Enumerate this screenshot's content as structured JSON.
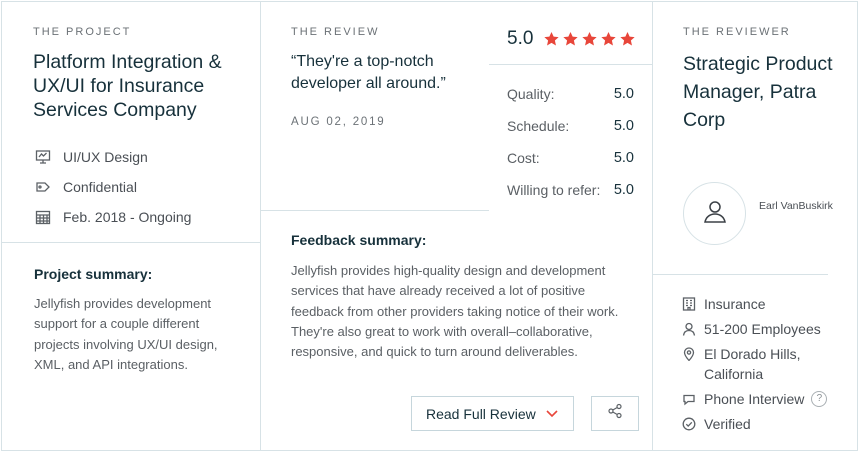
{
  "project": {
    "eyebrow": "THE PROJECT",
    "title": "Platform Integration & UX/UI for Insurance Services Company",
    "meta": [
      {
        "icon": "design-icon",
        "label": "UI/UX Design"
      },
      {
        "icon": "price-tag-icon",
        "label": "Confidential"
      },
      {
        "icon": "calendar-icon",
        "label": "Feb. 2018 - Ongoing"
      }
    ],
    "summary_heading": "Project summary:",
    "summary_text": "Jellyfish provides development support for a couple different projects involving UX/UI design, XML, and API integrations."
  },
  "review": {
    "eyebrow": "THE REVIEW",
    "quote": "“They're a top-notch developer all around.”",
    "date": "AUG 02, 2019",
    "overall_score": "5.0",
    "star_count": 5,
    "star_color": "#e8463a",
    "ratings": [
      {
        "label": "Quality:",
        "value": "5.0"
      },
      {
        "label": "Schedule:",
        "value": "5.0"
      },
      {
        "label": "Cost:",
        "value": "5.0"
      },
      {
        "label": "Willing to refer:",
        "value": "5.0"
      }
    ],
    "feedback_heading": "Feedback summary:",
    "feedback_text": "Jellyfish provides high-quality design and development services that have already received a lot of positive feedback from other providers taking notice of their work. They're also great to work with overall–collaborative, responsive, and quick to turn around deliverables.",
    "read_full_label": "Read Full Review"
  },
  "reviewer": {
    "eyebrow": "THE REVIEWER",
    "title": "Strategic Product Manager, Patra Corp",
    "name": "Earl VanBuskirk",
    "info": [
      {
        "icon": "building-icon",
        "label": "Insurance"
      },
      {
        "icon": "person-icon",
        "label": "51-200 Employees"
      },
      {
        "icon": "location-pin-icon",
        "label": "El Dorado Hills, California"
      },
      {
        "icon": "chat-bubble-icon",
        "label": "Phone Interview",
        "help": "?"
      },
      {
        "icon": "check-circle-icon",
        "label": "Verified"
      }
    ]
  }
}
